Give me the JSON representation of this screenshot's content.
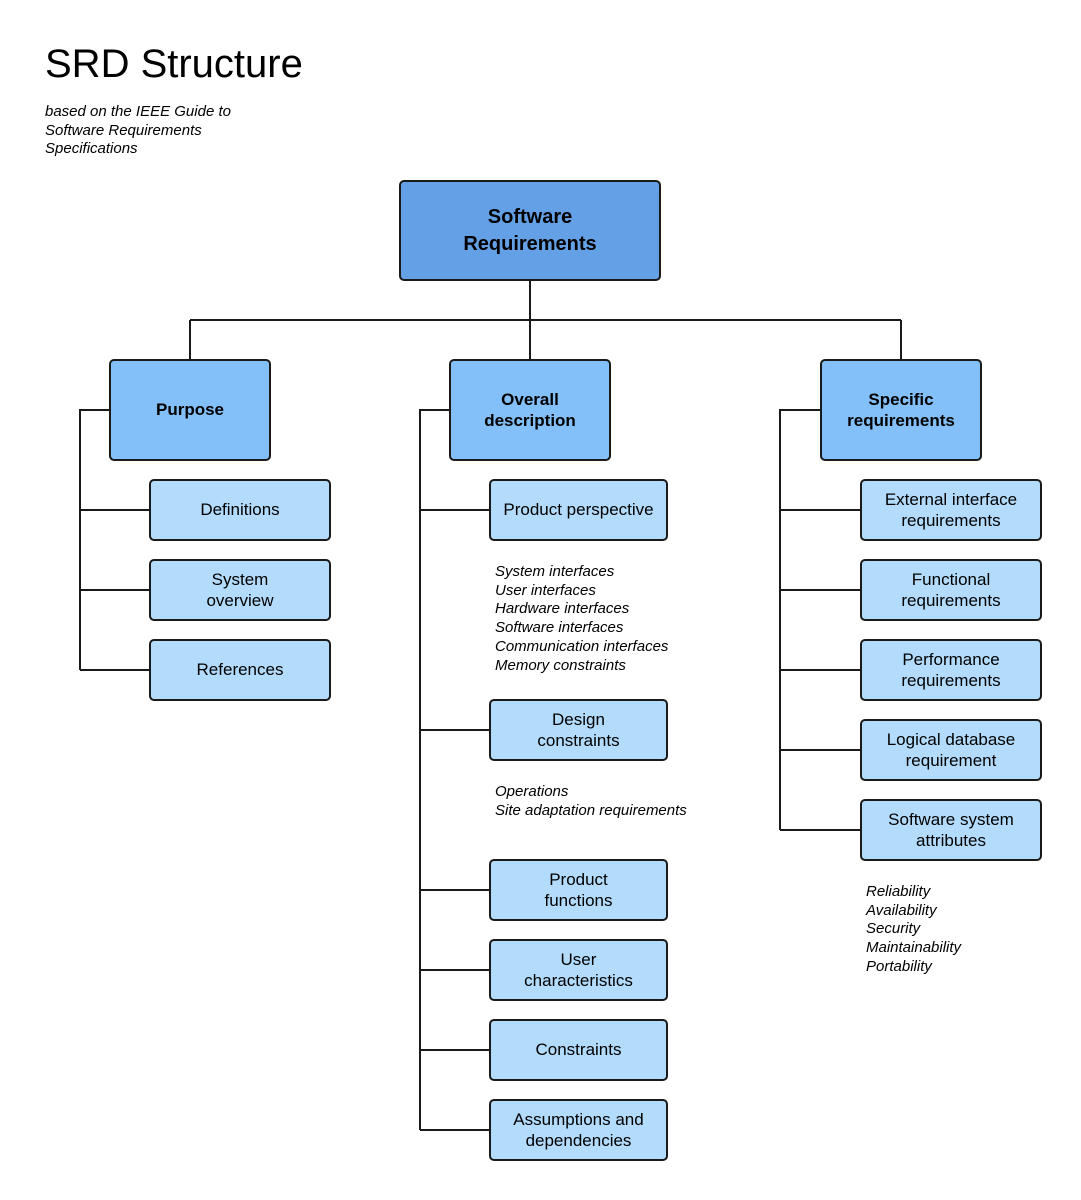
{
  "title": "SRD Structure",
  "subtitle": "based on the IEEE Guide to\nSoftware Requirements\nSpecifications",
  "colors": {
    "root_fill": "#64a0e6",
    "category_fill": "#83bff8",
    "leaf_fill": "#b2dbfc",
    "stroke": "#1a1a1a"
  },
  "root": {
    "label": "Software\nRequirements"
  },
  "categories": [
    {
      "label": "Purpose",
      "children": [
        {
          "label": "Definitions"
        },
        {
          "label": "System\noverview"
        },
        {
          "label": "References"
        }
      ]
    },
    {
      "label": "Overall\ndescription",
      "children": [
        {
          "label": "Product perspective",
          "notes": [
            "System interfaces",
            "User interfaces",
            "Hardware interfaces",
            "Software interfaces",
            "Communication interfaces",
            "Memory constraints"
          ]
        },
        {
          "label": "Design\nconstraints",
          "notes": [
            "Operations",
            "Site adaptation requirements"
          ]
        },
        {
          "label": "Product\nfunctions"
        },
        {
          "label": "User\ncharacteristics"
        },
        {
          "label": "Constraints"
        },
        {
          "label": "Assumptions and\ndependencies"
        }
      ]
    },
    {
      "label": "Specific\nrequirements",
      "children": [
        {
          "label": "External interface\nrequirements"
        },
        {
          "label": "Functional\nrequirements"
        },
        {
          "label": "Performance\nrequirements"
        },
        {
          "label": "Logical database\nrequirement"
        },
        {
          "label": "Software system\nattributes",
          "notes": [
            "Reliability",
            "Availability",
            "Security",
            "Maintainability",
            "Portability"
          ]
        }
      ]
    }
  ]
}
